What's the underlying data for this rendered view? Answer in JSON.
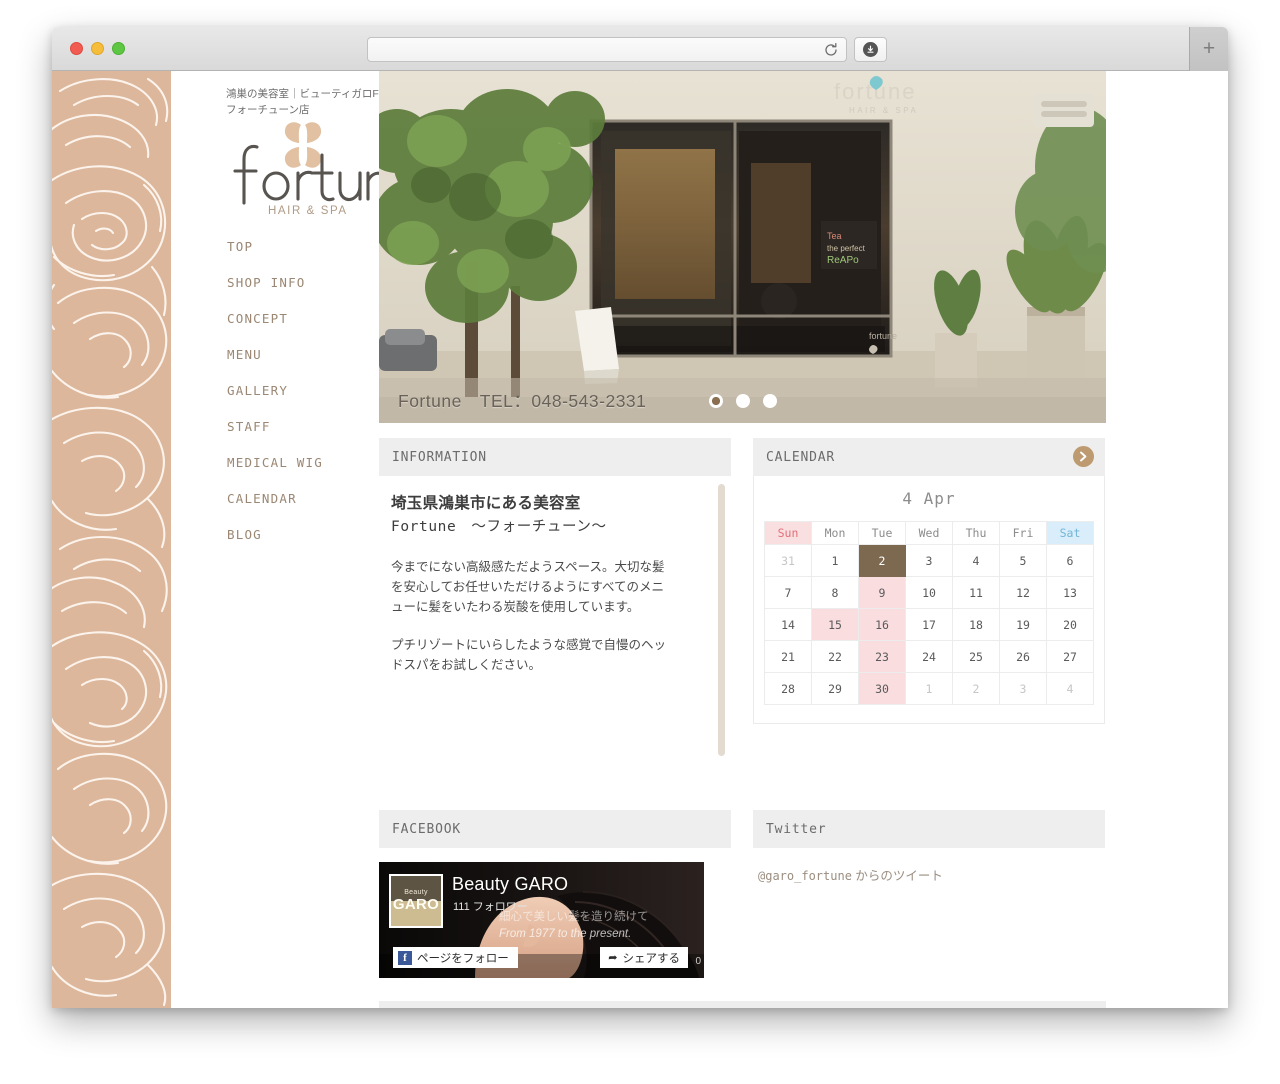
{
  "browser": {
    "url_value": "",
    "url_placeholder": "",
    "reload_label": "↻",
    "download_label": "⬇",
    "newtab_label": "+"
  },
  "site": {
    "tagline_line1": "鴻巣の美容室｜ビューティガロFortune",
    "tagline_line2": "フォーチューン店",
    "logo_word": "fortune",
    "logo_sub": "HAIR & SPA"
  },
  "nav": {
    "items": [
      {
        "label": "TOP"
      },
      {
        "label": "SHOP INFO"
      },
      {
        "label": "CONCEPT"
      },
      {
        "label": "MENU"
      },
      {
        "label": "GALLERY"
      },
      {
        "label": "STAFF"
      },
      {
        "label": "MEDICAL WIG"
      },
      {
        "label": "CALENDAR"
      },
      {
        "label": "BLOG"
      }
    ]
  },
  "hero": {
    "sign_text": "fortune",
    "sign_sub": "HAIR & SPA",
    "caption": "Fortune　TEL：048-543-2331",
    "slide_count": 3,
    "active_slide": 1
  },
  "information": {
    "panel_title": "INFORMATION",
    "heading": "埼玉県鴻巣市にある美容室",
    "subheading": "Fortune　～フォーチューン～",
    "paragraph1": "今までにない高級感ただようスペース。大切な髪を安心してお任せいただけるようにすべてのメニューに髪をいたわる炭酸を使用しています。",
    "paragraph2": "プチリゾートにいらしたような感覚で自慢のヘッドスパをお試しください。"
  },
  "calendar": {
    "panel_title": "CALENDAR",
    "more_icon": "chevron-right-icon",
    "month_label": "4 Apr",
    "weekdays": [
      "Sun",
      "Mon",
      "Tue",
      "Wed",
      "Thu",
      "Fri",
      "Sat"
    ],
    "weeks": [
      [
        {
          "day": "31",
          "state": "muted"
        },
        {
          "day": "1",
          "state": "normal"
        },
        {
          "day": "2",
          "state": "today"
        },
        {
          "day": "3",
          "state": "normal"
        },
        {
          "day": "4",
          "state": "normal"
        },
        {
          "day": "5",
          "state": "normal"
        },
        {
          "day": "6",
          "state": "normal"
        }
      ],
      [
        {
          "day": "7",
          "state": "normal"
        },
        {
          "day": "8",
          "state": "normal"
        },
        {
          "day": "9",
          "state": "pink"
        },
        {
          "day": "10",
          "state": "normal"
        },
        {
          "day": "11",
          "state": "normal"
        },
        {
          "day": "12",
          "state": "normal"
        },
        {
          "day": "13",
          "state": "normal"
        }
      ],
      [
        {
          "day": "14",
          "state": "normal"
        },
        {
          "day": "15",
          "state": "pink"
        },
        {
          "day": "16",
          "state": "pink"
        },
        {
          "day": "17",
          "state": "normal"
        },
        {
          "day": "18",
          "state": "normal"
        },
        {
          "day": "19",
          "state": "normal"
        },
        {
          "day": "20",
          "state": "normal"
        }
      ],
      [
        {
          "day": "21",
          "state": "normal"
        },
        {
          "day": "22",
          "state": "normal"
        },
        {
          "day": "23",
          "state": "pink"
        },
        {
          "day": "24",
          "state": "normal"
        },
        {
          "day": "25",
          "state": "normal"
        },
        {
          "day": "26",
          "state": "normal"
        },
        {
          "day": "27",
          "state": "normal"
        }
      ],
      [
        {
          "day": "28",
          "state": "normal"
        },
        {
          "day": "29",
          "state": "normal"
        },
        {
          "day": "30",
          "state": "pink"
        },
        {
          "day": "1",
          "state": "muted"
        },
        {
          "day": "2",
          "state": "muted"
        },
        {
          "day": "3",
          "state": "muted"
        },
        {
          "day": "4",
          "state": "muted"
        }
      ]
    ]
  },
  "facebook": {
    "panel_title": "FACEBOOK",
    "page_name": "Beauty GARO",
    "followers": "111 フォロワー",
    "avatar_top": "Beauty",
    "avatar_bottom": "GARO",
    "tagline1": "細心で美しい髪を造り続けて",
    "tagline2": "From 1977 to the present.",
    "follow_button": "ページをフォロー",
    "share_button": "シェアする",
    "fb_mark": "f",
    "share_icon": "➦",
    "corner_mark": "0"
  },
  "twitter": {
    "panel_title": "Twitter",
    "handle": "@garo_fortune",
    "link_suffix": " からのツイート"
  },
  "colors": {
    "accent_tan": "#bd9a6f",
    "rose_bg": "#dcb79b",
    "nav_text": "#9b8773",
    "today_brown": "#7d6850",
    "holiday_pink": "#fadddf",
    "sunday_red": "#e2707a",
    "saturday_blue": "#73b5d8"
  }
}
